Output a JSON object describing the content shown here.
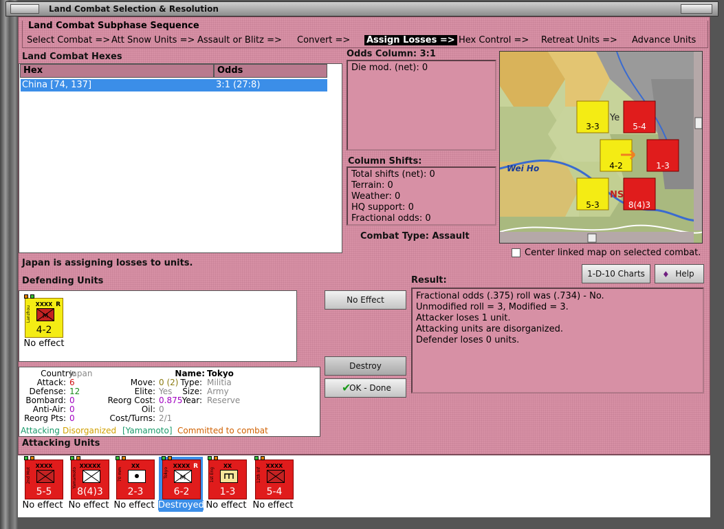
{
  "window": {
    "title": "Land Combat Selection & Resolution"
  },
  "subphase": {
    "label": "Land Combat Subphase Sequence",
    "steps": [
      "Select Combat =>",
      "Att Snow Units =>",
      "Assault or Blitz =>",
      "Convert =>",
      "Assign Losses =>",
      "Hex Control =>",
      "Retreat Units =>",
      "Advance Units"
    ],
    "active_index": 4
  },
  "hexes": {
    "label": "Land Combat Hexes",
    "columns": [
      "Hex",
      "Odds"
    ],
    "rows": [
      {
        "hex": "China [74, 137]",
        "odds": "3:1 (27:8)"
      }
    ]
  },
  "odds": {
    "label": "Odds Column: 3:1",
    "lines": [
      "Die mod. (net): 0"
    ]
  },
  "shifts": {
    "label": "Column Shifts:",
    "lines": [
      "Total shifts (net): 0",
      "Terrain: 0",
      "Weather: 0",
      "HQ support: 0",
      "Fractional odds: 0"
    ]
  },
  "combat_type": "Combat Type:  Assault",
  "status": "Japan is assigning losses to units.",
  "center_map": {
    "label": "Center linked map on selected combat.",
    "checked": false
  },
  "buttons": {
    "charts": "1-D-10 Charts",
    "help": "Help",
    "no_effect": "No Effect",
    "destroy": "Destroy",
    "ok": "OK - Done"
  },
  "result": {
    "label": "Result:",
    "lines": [
      "Fractional odds (.375) roll was (.734)  - No.",
      "Unmodified roll = 3, Modified = 3.",
      "Attacker loses 1 unit.",
      "Attacking units are disorganized.",
      "Defender loses 0 units."
    ]
  },
  "defending": {
    "label": "Defending Units",
    "units": [
      {
        "name": "Lanzhou",
        "size": "XXXX",
        "strength": "4-2",
        "flag": "R",
        "effect": "No effect"
      }
    ]
  },
  "unit_info": {
    "country_k": "Country:",
    "country_v": "Japan",
    "attack_k": "Attack:",
    "attack_v": "6",
    "defense_k": "Defense:",
    "defense_v": "12",
    "bombard_k": "Bombard:",
    "bombard_v": "0",
    "antiair_k": "Anti-Air:",
    "antiair_v": "0",
    "reorg_k": "Reorg Pts:",
    "reorg_v": "0",
    "name_k": "Name:",
    "name_v": "Tokyo",
    "move_k": "Move:",
    "move_v": "0 (2)",
    "elite_k": "Elite:",
    "elite_v": "Yes",
    "reorgcost_k": "Reorg Cost:",
    "reorgcost_v": "0.875",
    "oil_k": "Oil:",
    "oil_v": "0",
    "cost_k": "Cost/Turns:",
    "cost_v": "2/1",
    "type_k": "Type:",
    "type_v": "Militia",
    "size_k": "Size:",
    "size_v": "Army",
    "year_k": "Year:",
    "year_v": "Reserve",
    "tag_attacking": "Attacking",
    "tag_disorg": "Disorganized",
    "tag_yamamoto": "[Yamamoto]",
    "tag_committed": "Committed to combat"
  },
  "attacking": {
    "label": "Attacking Units",
    "units": [
      {
        "name": "2nd Mot",
        "size": "XXXX",
        "strength": "5-5",
        "effect": "No effect"
      },
      {
        "name": "Yamamoto",
        "size": "XXXXX",
        "strength": "8(4)3",
        "effect": "No effect"
      },
      {
        "name": "70 mm",
        "size": "XX",
        "strength": "2-3",
        "effect": "No effect"
      },
      {
        "name": "Tokyo",
        "size": "XXXX",
        "strength": "6-2",
        "flag": "R",
        "effect": "Destroyed"
      },
      {
        "name": "1st Eng",
        "size": "XX",
        "strength": "1-3",
        "effect": "No effect"
      },
      {
        "name": "12th Inf",
        "size": "XXXX",
        "strength": "5-4",
        "effect": "No effect"
      }
    ]
  },
  "map": {
    "labels": [
      "Wei Ho",
      "Ye",
      "NS"
    ],
    "counters": [
      {
        "size": "XXXX",
        "strength": "3-3"
      },
      {
        "size": "XXXX",
        "strength": "5-4"
      },
      {
        "size": "XXXX",
        "strength": "4-2"
      },
      {
        "size": "XX",
        "strength": "1-3"
      },
      {
        "size": "XXXX",
        "strength": "5-3"
      },
      {
        "size": "XXXXX",
        "strength": "8(4)3"
      }
    ]
  },
  "colors": {
    "panel_pink": "#d790a5",
    "selection_blue": "#3b8ee8",
    "counter_red": "#e01c1c",
    "counter_yellow": "#f4ec14",
    "attack_red": "#d01010",
    "defense_green": "#1a8a1a",
    "purple": "#a000c0"
  }
}
